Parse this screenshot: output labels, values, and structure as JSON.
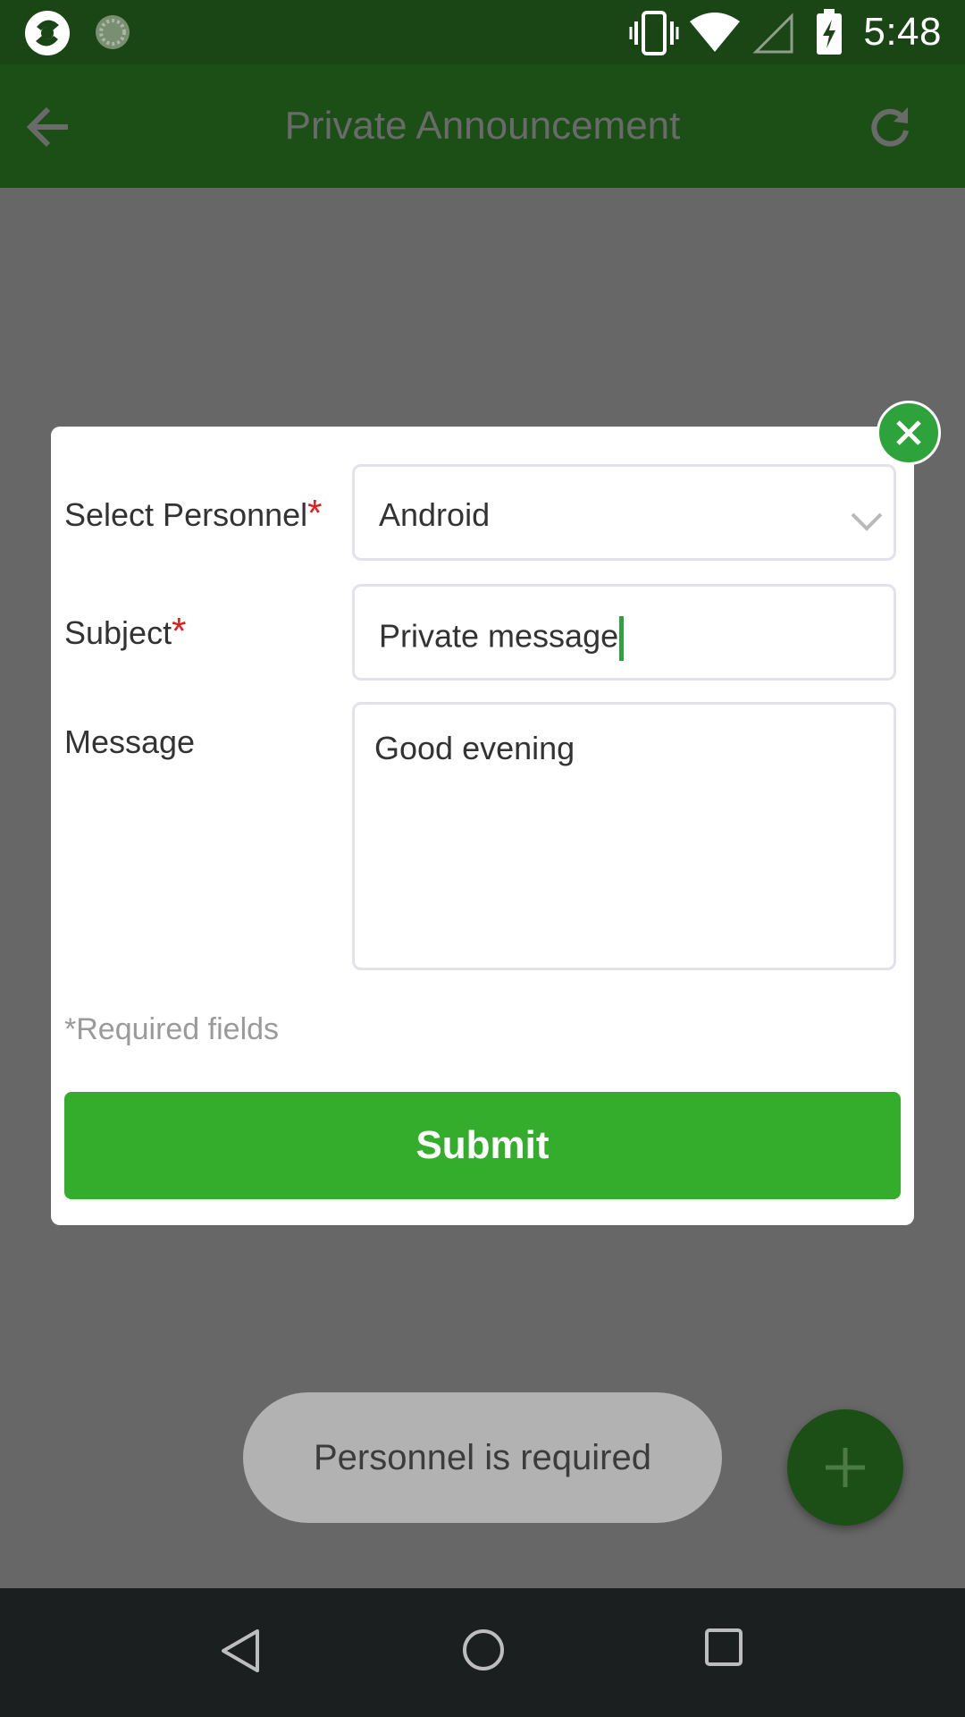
{
  "status_bar": {
    "time": "5:48",
    "icons": [
      "app-logo-icon",
      "sync-icon",
      "vibrate-icon",
      "wifi-icon",
      "signal-icon",
      "battery-charging-icon"
    ]
  },
  "app_bar": {
    "title": "Private Announcement",
    "back_icon": "arrow-left-icon",
    "refresh_icon": "refresh-icon"
  },
  "dialog": {
    "personnel": {
      "label": "Select Personnel",
      "required_mark": "*",
      "value": "Android"
    },
    "subject": {
      "label": "Subject",
      "required_mark": "*",
      "value": "Private message"
    },
    "message": {
      "label": "Message",
      "value": "Good evening"
    },
    "required_note": "*Required fields",
    "submit_label": "Submit",
    "close_icon": "close-icon"
  },
  "toast": {
    "text": "Personnel is required"
  },
  "fab": {
    "icon": "plus-icon"
  },
  "nav_bar": {
    "icons": [
      "back-triangle-icon",
      "home-circle-icon",
      "recents-square-icon"
    ]
  },
  "colors": {
    "primary_dark": "#1b4f16",
    "accent_green": "#35ad2c",
    "required_red": "#e21b1b",
    "overlay": "#676767"
  }
}
